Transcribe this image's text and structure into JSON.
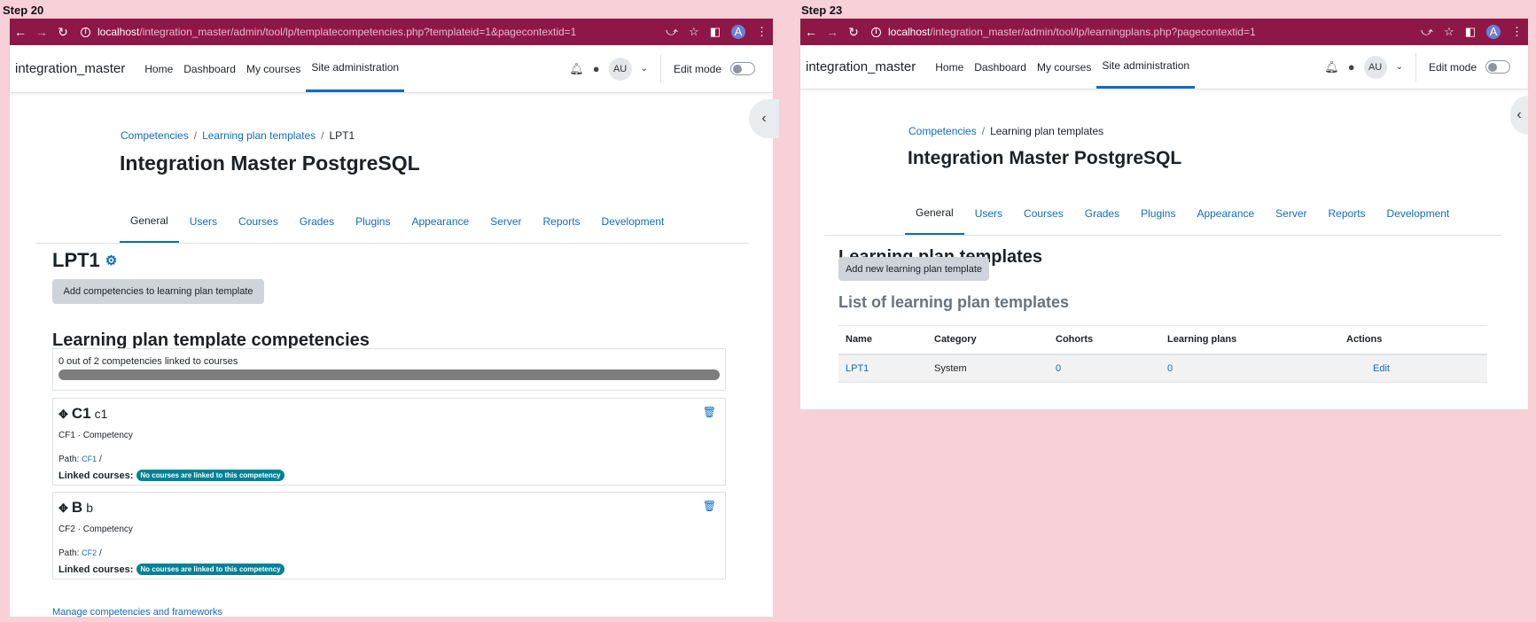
{
  "left": {
    "step_label": "Step 20",
    "url_host": "localhost",
    "url_path": "/integration_master/admin/tool/lp/templatecompetencies.php?templateid=1&pagecontextid=1",
    "brand": "integration_master",
    "nav": [
      "Home",
      "Dashboard",
      "My courses",
      "Site administration"
    ],
    "avatar": "AU",
    "edit_mode": "Edit mode",
    "breadcrumbs": [
      "Competencies",
      "Learning plan templates",
      "LPT1"
    ],
    "site_title": "Integration Master PostgreSQL",
    "tabs": [
      "General",
      "Users",
      "Courses",
      "Grades",
      "Plugins",
      "Appearance",
      "Server",
      "Reports",
      "Development"
    ],
    "page_heading": "LPT1",
    "add_button": "Add competencies to learning plan template",
    "section_heading": "Learning plan template competencies",
    "progress_text": "0 out of 2 competencies linked to courses",
    "progress_fraction": 1.0,
    "competencies": [
      {
        "short": "C1",
        "idnumber": "c1",
        "sub": "CF1 · Competency",
        "path_label": "Path:",
        "path_link": "CF1",
        "path_sep": "/",
        "linked_label": "Linked courses:",
        "badge": "No courses are linked to this competency"
      },
      {
        "short": "B",
        "idnumber": "b",
        "sub": "CF2 · Competency",
        "path_label": "Path:",
        "path_link": "CF2",
        "path_sep": "/",
        "linked_label": "Linked courses:",
        "badge": "No courses are linked to this competency"
      }
    ],
    "manage_link": "Manage competencies and frameworks"
  },
  "right": {
    "step_label": "Step 23",
    "url_host": "localhost",
    "url_path": "/integration_master/admin/tool/lp/learningplans.php?pagecontextid=1",
    "brand": "integration_master",
    "nav": [
      "Home",
      "Dashboard",
      "My courses",
      "Site administration"
    ],
    "avatar": "AU",
    "edit_mode": "Edit mode",
    "breadcrumbs": [
      "Competencies",
      "Learning plan templates"
    ],
    "site_title": "Integration Master PostgreSQL",
    "tabs": [
      "General",
      "Users",
      "Courses",
      "Grades",
      "Plugins",
      "Appearance",
      "Server",
      "Reports",
      "Development"
    ],
    "page_heading": "Learning plan templates",
    "add_button": "Add new learning plan template",
    "list_heading": "List of learning plan templates",
    "table": {
      "headers": [
        "Name",
        "Category",
        "Cohorts",
        "Learning plans",
        "Actions"
      ],
      "rows": [
        [
          "LPT1",
          "System",
          "0",
          "0",
          "Edit"
        ]
      ]
    }
  }
}
